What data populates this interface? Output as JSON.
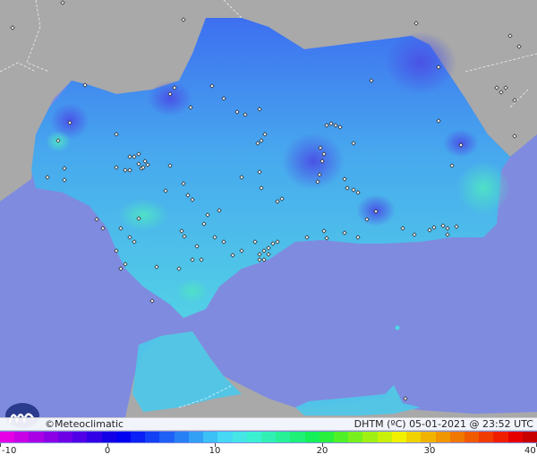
{
  "credit": {
    "copyright": "©Meteoclimatic",
    "stamp": "DHTM (ºC)  05-01-2021 @ 23:52 UTC"
  },
  "legend": {
    "min": -10,
    "max": 40,
    "tick_values": [
      -10,
      0,
      10,
      20,
      30,
      40
    ],
    "tick_labels": [
      "-10",
      "0",
      "10",
      "20",
      "30",
      "40"
    ],
    "colors": [
      "#e600e6",
      "#c800e6",
      "#aa00e6",
      "#8c00e6",
      "#6e00e6",
      "#5000e6",
      "#3200e6",
      "#1400e6",
      "#0000f0",
      "#0a20f5",
      "#1440f5",
      "#1e60f5",
      "#2880f5",
      "#32a0f5",
      "#3cc0f5",
      "#46d8f5",
      "#46e6e6",
      "#3cf0d2",
      "#32f0b4",
      "#28f096",
      "#1ef078",
      "#14f05a",
      "#28f03c",
      "#50f028",
      "#78f01e",
      "#a0f014",
      "#c8f00a",
      "#f0f000",
      "#f0d200",
      "#f0b400",
      "#f09600",
      "#f07800",
      "#f05a00",
      "#f03c00",
      "#f01e00",
      "#e60000",
      "#c80000"
    ]
  },
  "map": {
    "sea_color": "#7f8bdf",
    "land_outside_color": "#a9a9a9",
    "region_color": "#4fb8ee"
  }
}
